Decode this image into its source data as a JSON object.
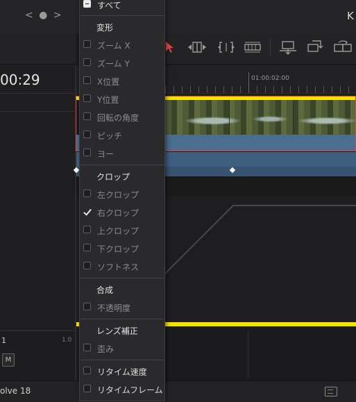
{
  "header": {
    "pager": "< ● >",
    "corner_letter": "K"
  },
  "timeline": {
    "timecode": "00:29",
    "ruler_label": "01:00:02:00",
    "lower_left_value": "1",
    "lower_left_scale": "1.0",
    "m_button": "M"
  },
  "status": {
    "app_name": "olve 18"
  },
  "menu": {
    "all": {
      "label": "すべて",
      "state": "partial"
    },
    "sections": [
      {
        "heading": "変形",
        "items": [
          {
            "label": "ズーム X",
            "checked": false,
            "enabled": false
          },
          {
            "label": "ズーム Y",
            "checked": false,
            "enabled": false
          },
          {
            "label": "X位置",
            "checked": false,
            "enabled": false
          },
          {
            "label": "Y位置",
            "checked": false,
            "enabled": false
          },
          {
            "label": "回転の角度",
            "checked": false,
            "enabled": false
          },
          {
            "label": "ピッチ",
            "checked": false,
            "enabled": false
          },
          {
            "label": "ヨー",
            "checked": false,
            "enabled": false
          }
        ]
      },
      {
        "heading": "クロップ",
        "items": [
          {
            "label": "左クロップ",
            "checked": false,
            "enabled": false
          },
          {
            "label": "右クロップ",
            "checked": true,
            "enabled": false
          },
          {
            "label": "上クロップ",
            "checked": false,
            "enabled": false
          },
          {
            "label": "下クロップ",
            "checked": false,
            "enabled": false
          },
          {
            "label": "ソフトネス",
            "checked": false,
            "enabled": false
          }
        ]
      },
      {
        "heading": "合成",
        "items": [
          {
            "label": "不透明度",
            "checked": false,
            "enabled": false
          }
        ]
      },
      {
        "heading": "レンズ補正",
        "items": [
          {
            "label": "歪み",
            "checked": false,
            "enabled": false
          }
        ]
      }
    ],
    "retime": [
      {
        "label": "リタイム速度",
        "checked": false,
        "enabled": true
      },
      {
        "label": "リタイムフレーム",
        "checked": false,
        "enabled": true
      }
    ]
  },
  "colors": {
    "accent_yellow": "#f2e600",
    "clip_outline_red": "#d9463d",
    "clip_blue": "#4b6d8e",
    "cursor_red": "#e0463c"
  }
}
